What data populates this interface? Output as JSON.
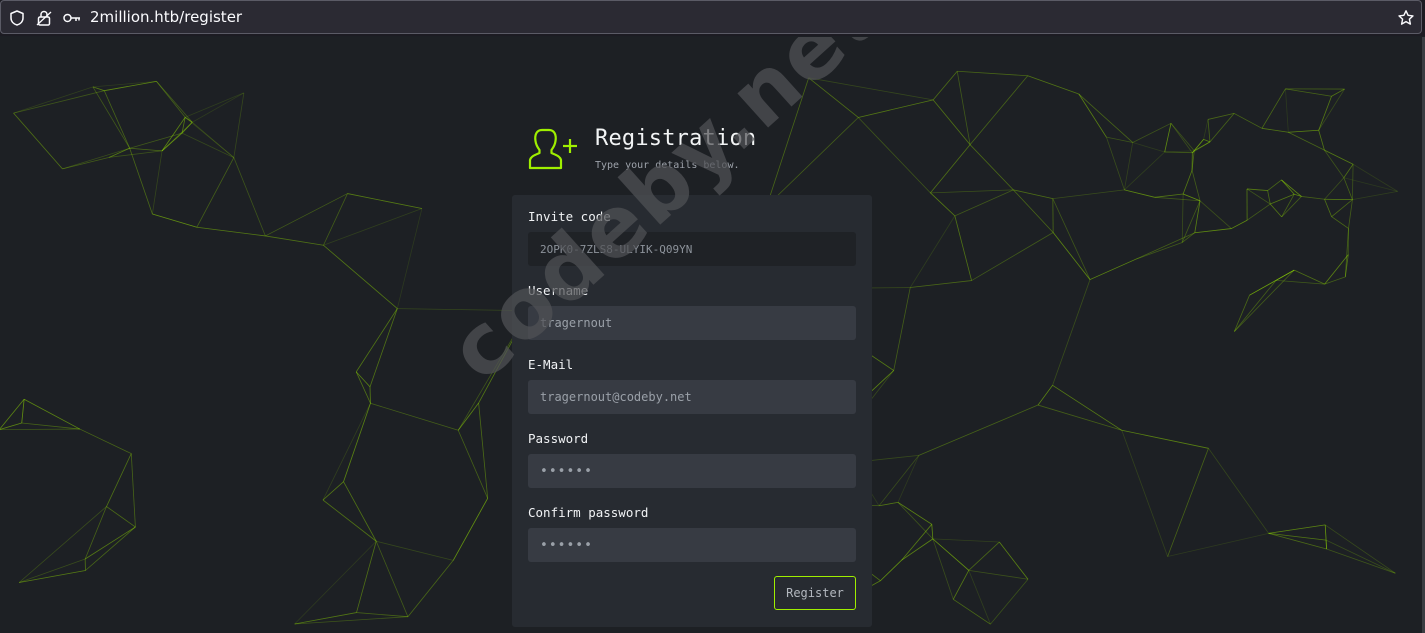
{
  "browser": {
    "url": "2million.htb/register",
    "icons": [
      "shield-icon",
      "lock-icon",
      "key-icon",
      "bookmark-star-icon"
    ]
  },
  "registration": {
    "title": "Registration",
    "subtitle": "Type your details below.",
    "icon": "user-add-icon",
    "accent_color": "#9fef00",
    "fields": {
      "invite_code": {
        "label": "Invite code",
        "value": "2OPK0-7ZLS8-ULYIK-Q09YN"
      },
      "username": {
        "label": "Username",
        "value": "tragernout"
      },
      "email": {
        "label": "E-Mail",
        "value": "tragernout@codeby.net"
      },
      "password": {
        "label": "Password",
        "value": "••••••"
      },
      "confirm_password": {
        "label": "Confirm password",
        "value": "••••••"
      }
    },
    "submit_label": "Register"
  },
  "watermark": "codeby.net"
}
